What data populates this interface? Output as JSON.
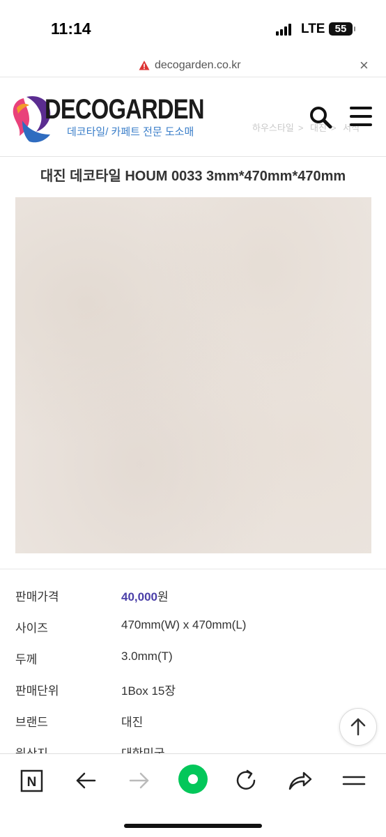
{
  "status_bar": {
    "time": "11:14",
    "network": "LTE",
    "battery": "55"
  },
  "url_bar": {
    "domain": "decogarden.co.kr"
  },
  "header": {
    "logo_text": "DECOGARDEN",
    "logo_subtitle": "데코타일/ 카페트 전문 도소매",
    "breadcrumb": [
      "하우스타일",
      "대진",
      "서식"
    ]
  },
  "product": {
    "title": "대진 데코타일 HOUM 0033 3mm*470mm*470mm",
    "specs": [
      {
        "label": "판매가격",
        "value": "40,000",
        "suffix": "원"
      },
      {
        "label": "사이즈",
        "value": "470mm(W) x 470mm(L)"
      },
      {
        "label": "두께",
        "value": "3.0mm(T)"
      },
      {
        "label": "판매단위",
        "value": "1Box 15장"
      },
      {
        "label": "브랜드",
        "value": "대진"
      },
      {
        "label": "원산지",
        "value": "대한민국"
      }
    ]
  },
  "colors": {
    "price": "#4a3fa8",
    "naver_green": "#03c75a",
    "logo_purple": "#5b2d91",
    "logo_pink": "#e9417a"
  },
  "toolbar_icons": [
    "naver-n-icon",
    "back-arrow-icon",
    "forward-arrow-icon",
    "naver-green-dot-icon",
    "reload-icon",
    "share-icon",
    "menu-icon"
  ]
}
